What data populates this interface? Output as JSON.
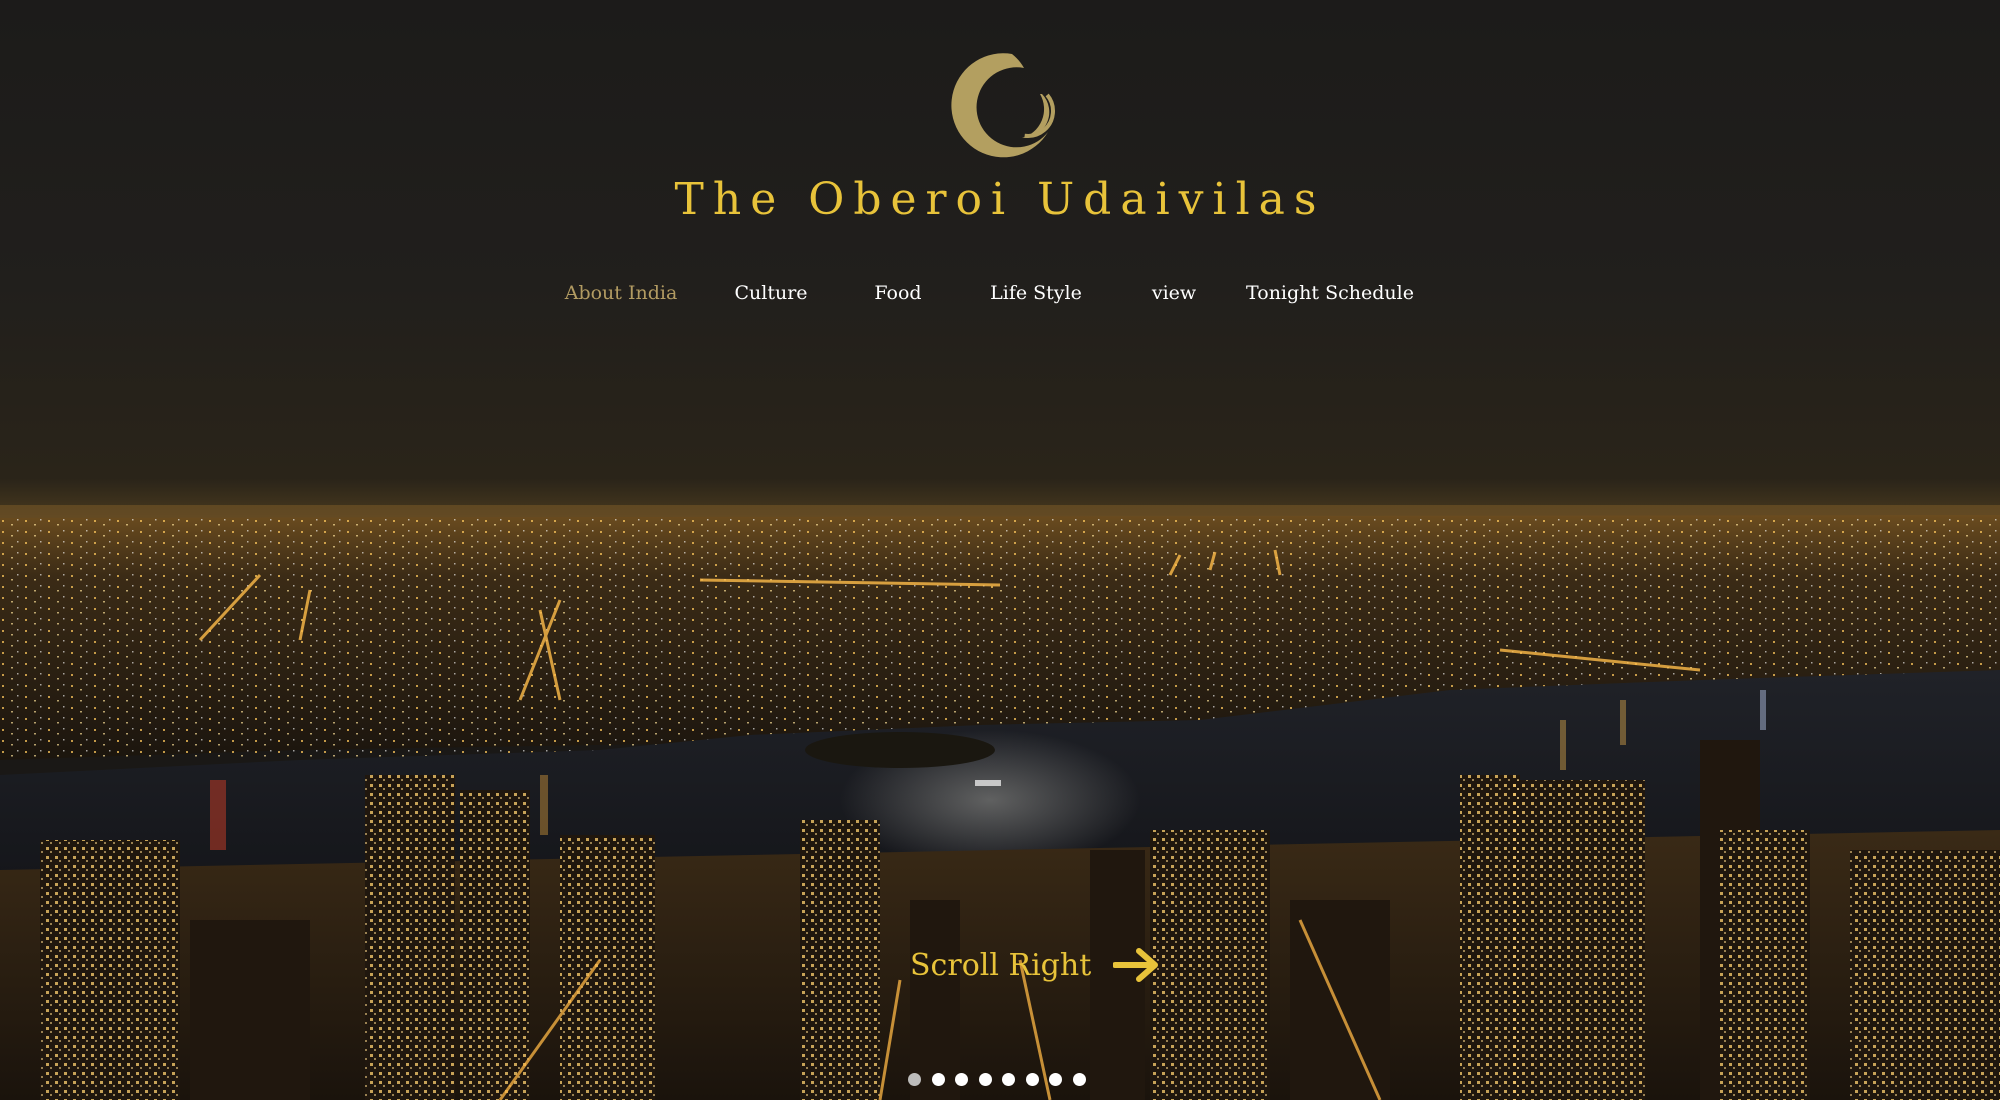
{
  "brand": {
    "name": "The Oberoi Udaivilas",
    "color": "#e8c33a"
  },
  "nav": {
    "items": [
      {
        "label": "About India",
        "active": true
      },
      {
        "label": "Culture",
        "active": false
      },
      {
        "label": "Food",
        "active": false
      },
      {
        "label": "Life Style",
        "active": false
      },
      {
        "label": "view",
        "active": false
      },
      {
        "label": "Tonight Schedule",
        "active": false
      }
    ],
    "active_color": "#b29b62",
    "color": "#ffffff"
  },
  "scroll_cue": {
    "label": "Scroll Right",
    "icon": "arrow-right-icon"
  },
  "slider": {
    "total_slides": 8,
    "current_slide": 1
  },
  "background": {
    "description_icon": "night-city-skyline-image"
  }
}
